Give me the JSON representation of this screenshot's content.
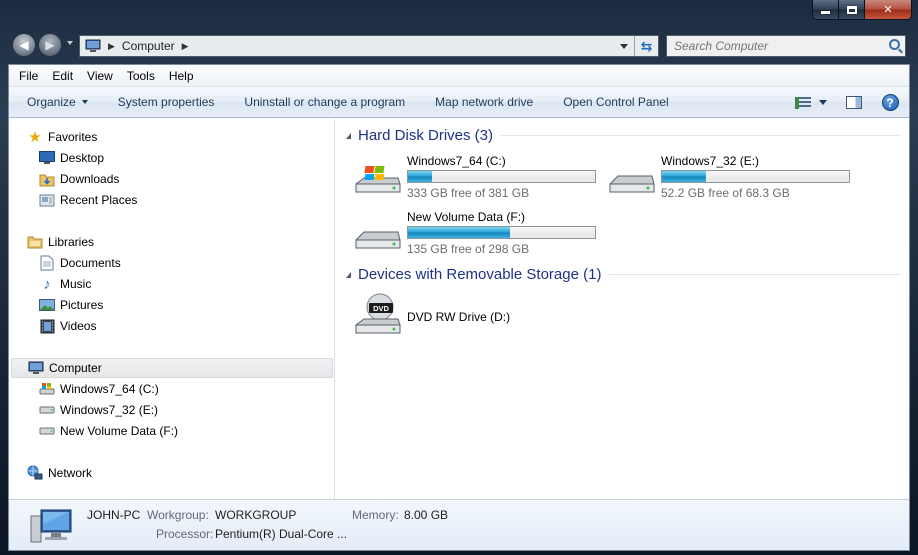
{
  "window": {
    "caption": {
      "minimize": "minimize",
      "maximize": "maximize",
      "close": "close"
    }
  },
  "nav": {
    "address_crumb": "Computer",
    "search_placeholder": "Search Computer"
  },
  "menu": [
    "File",
    "Edit",
    "View",
    "Tools",
    "Help"
  ],
  "commands": {
    "organize": "Organize",
    "items": [
      "System properties",
      "Uninstall or change a program",
      "Map network drive",
      "Open Control Panel"
    ]
  },
  "sidebar": {
    "favorites": {
      "label": "Favorites",
      "items": [
        "Desktop",
        "Downloads",
        "Recent Places"
      ]
    },
    "libraries": {
      "label": "Libraries",
      "items": [
        "Documents",
        "Music",
        "Pictures",
        "Videos"
      ]
    },
    "computer": {
      "label": "Computer",
      "items": [
        "Windows7_64 (C:)",
        "Windows7_32 (E:)",
        "New Volume Data (F:)"
      ]
    },
    "network": {
      "label": "Network"
    }
  },
  "content": {
    "hdd_group": "Hard Disk Drives (3)",
    "removable_group": "Devices with Removable Storage (1)",
    "drives": [
      {
        "name": "Windows7_64 (C:)",
        "free": "333 GB free of 381 GB",
        "used_fraction": 0.126,
        "icon": "windows-drive-icon"
      },
      {
        "name": "Windows7_32 (E:)",
        "free": "52.2 GB free of 68.3 GB",
        "used_fraction": 0.236,
        "icon": "hard-drive-icon"
      },
      {
        "name": "New Volume Data (F:)",
        "free": "135 GB free of 298 GB",
        "used_fraction": 0.547,
        "icon": "hard-drive-icon"
      }
    ],
    "dvd": {
      "name": "DVD RW Drive (D:)",
      "badge": "DVD"
    }
  },
  "details": {
    "pc_name": "JOHN-PC",
    "workgroup_label": "Workgroup:",
    "workgroup_value": "WORKGROUP",
    "memory_label": "Memory:",
    "memory_value": "8.00 GB",
    "processor_label": "Processor:",
    "processor_value": "Pentium(R) Dual-Core ..."
  },
  "colors": {
    "group_title": "#1e3287",
    "bar_fill": "#26a0da",
    "command_text": "#1e395b"
  }
}
